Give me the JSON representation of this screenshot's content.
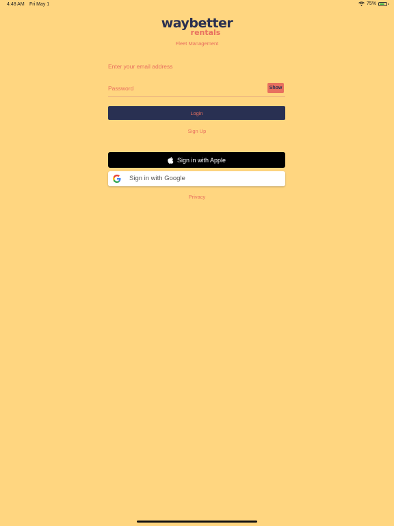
{
  "status_bar": {
    "time": "4:48 AM",
    "date": "Fri May 1",
    "battery": "75%",
    "battery_level": 0.75,
    "wifi_icon": "wifi-icon",
    "battery_icon": "battery-icon"
  },
  "brand": {
    "name": "waybetter",
    "sub": "rentals",
    "tagline": "Fleet Management",
    "primary_color": "#2A3050",
    "accent_color": "#E8705F",
    "background_color": "#FFD680"
  },
  "login_form": {
    "email_placeholder": "Enter your email address",
    "password_placeholder": "Password",
    "show_label": "Show",
    "login_label": "Login",
    "signup_label": "Sign Up"
  },
  "social": {
    "apple_label": "Sign in with Apple",
    "apple_icon": "apple-icon",
    "google_label": "Sign in with Google",
    "google_icon": "google-icon"
  },
  "footer": {
    "privacy_label": "Privacy"
  }
}
